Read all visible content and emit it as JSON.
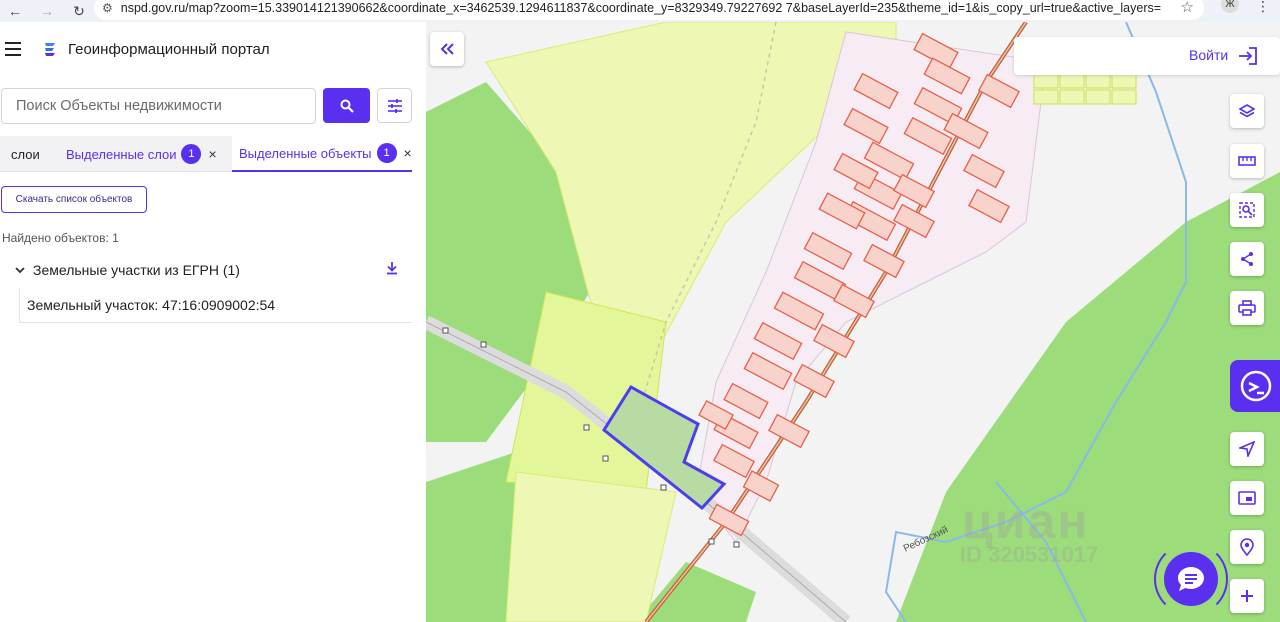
{
  "browser": {
    "url": "nspd.gov.ru/map?zoom=15.339014121390662&coordinate_x=3462539.1294611837&coordinate_y=8329349.79227692 7&baseLayerId=235&theme_id=1&is_copy_url=true&active_layers=360...",
    "profile_initial": "Ж",
    "icons": [
      "back-icon",
      "forward-icon",
      "reload-icon",
      "site-info-icon",
      "star-icon",
      "kebab-menu-icon"
    ]
  },
  "header": {
    "title": "Геоинформационный портал",
    "menu_icon": "hamburger-icon"
  },
  "search": {
    "placeholder": "Поиск Объекты недвижимости",
    "value": ""
  },
  "tabs": [
    {
      "label": "слои"
    },
    {
      "label": "Выделенные слои",
      "badge": "1",
      "close": "×"
    },
    {
      "label": "Выделенные объекты",
      "badge": "1",
      "close": "×",
      "active": true
    }
  ],
  "results": {
    "download_list_label": "Скачать список объектов",
    "found_text": "Найдено объектов: 1",
    "group_title": "Земельные участки из ЕГРН (1)",
    "items": [
      {
        "label": "Земельный участок: 47:16:0909002:54"
      }
    ]
  },
  "map": {
    "login_label": "Войти",
    "place_label": "Ребозский",
    "watermark_name": "циан",
    "watermark_id": "ID 320531017",
    "tools": [
      "layers-icon",
      "ruler-icon",
      "area-select-icon",
      "share-icon",
      "print-icon",
      "assistant-icon",
      "navigate-icon",
      "picture-in-picture-icon",
      "location-search-icon",
      "zoom-in-icon"
    ],
    "colors": {
      "accent": "#5a2ff0",
      "forest": "#9cdc7a",
      "zone_yellow": "#eef7b4",
      "parcel_red": "#f28b73",
      "selected_parcel": "#4a3ef0"
    }
  }
}
